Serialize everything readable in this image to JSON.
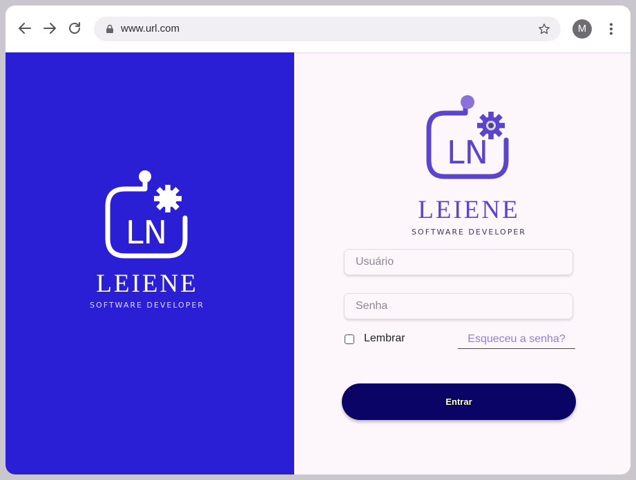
{
  "browser": {
    "url": "www.url.com",
    "avatar_initial": "M",
    "icons": [
      "back-icon",
      "forward-icon",
      "reload-icon",
      "lock-icon",
      "star-icon",
      "more-vert-icon"
    ]
  },
  "brand": {
    "name": "LEIENE",
    "tagline": "SOFTWARE DEVELOPER",
    "monogram": "LN"
  },
  "login": {
    "username_placeholder": "Usuário",
    "password_placeholder": "Senha",
    "remember_label": "Lembrar",
    "forgot_link": "Esqueceu a senha?",
    "submit_label": "Entrar"
  },
  "colors": {
    "left_panel": "#2a1fd4",
    "right_panel": "#fdf7fc",
    "logo_purple": "#5b45cc",
    "logo_dot": "#8a72d8",
    "button": "#0a0466",
    "link": "#8f80d6"
  }
}
